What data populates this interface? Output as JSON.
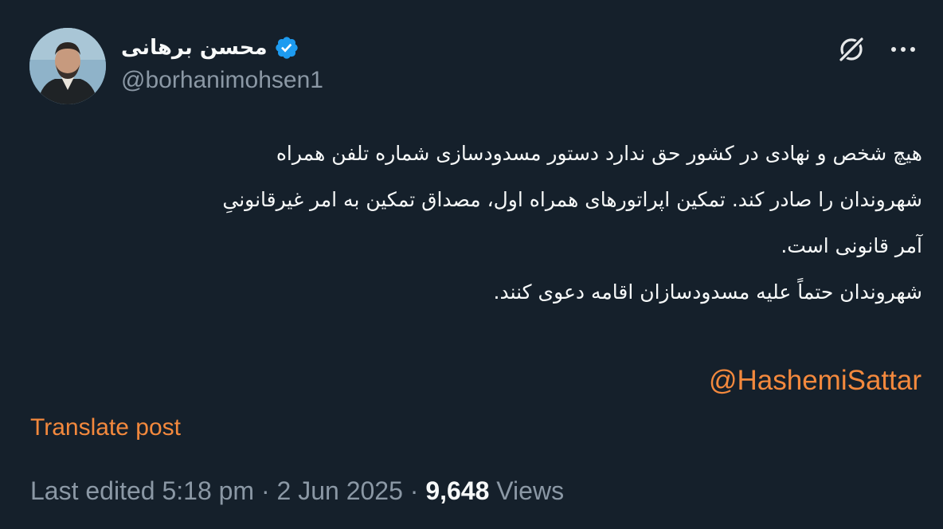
{
  "author": {
    "display_name": "محسن برهانی",
    "handle": "@borhanimohsen1",
    "verified_icon": "verified-badge-icon",
    "avatar_icon": "avatar"
  },
  "header_actions": {
    "grok_icon": "grok-icon",
    "more_icon": "more-horizontal-icon"
  },
  "tweet": {
    "lines": [
      "هیچ شخص و نهادی در کشور حق ندارد دستور مسدودسازی شماره تلفن همراه",
      "شهروندان را صادر کند. تمکین اپراتورهای همراه اول، مصداق تمکین به امر غیرقانونیِ",
      "آمر قانونی است.",
      "شهروندان حتماً علیه مسدودسازان اقامه دعوی کنند."
    ],
    "mention": "@HashemiSattar"
  },
  "translate_label": "Translate post",
  "meta": {
    "edited_label": "Last edited 5:18 pm · 2 Jun 2025 · ",
    "views_count": "9,648",
    "views_label": " Views"
  },
  "colors": {
    "background": "#15202b",
    "accent": "#f4893d",
    "verified": "#1d9bf0",
    "secondary_text": "#8b98a5"
  }
}
